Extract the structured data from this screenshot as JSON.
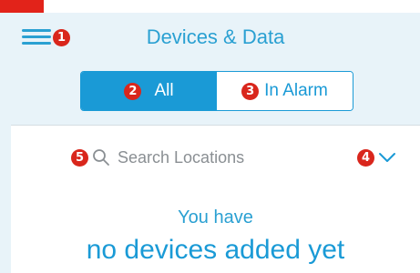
{
  "header": {
    "title": "Devices & Data"
  },
  "menu": {
    "badge": "1"
  },
  "filter": {
    "all": {
      "label": "All",
      "badge": "2"
    },
    "in_alarm": {
      "label": "In Alarm",
      "badge": "3"
    }
  },
  "search": {
    "placeholder": "Search Locations",
    "badge": "5"
  },
  "dropdown": {
    "badge": "4"
  },
  "empty_state": {
    "line1": "You have",
    "line2": "no devices added yet"
  },
  "icons": {
    "menu": "hamburger-icon",
    "search": "search-icon",
    "dropdown": "chevron-down-icon"
  },
  "colors": {
    "accent": "#1a9ad6",
    "header_bg": "#e8f3f9",
    "badge": "#d9261c",
    "muted_text": "#8a8f93"
  }
}
